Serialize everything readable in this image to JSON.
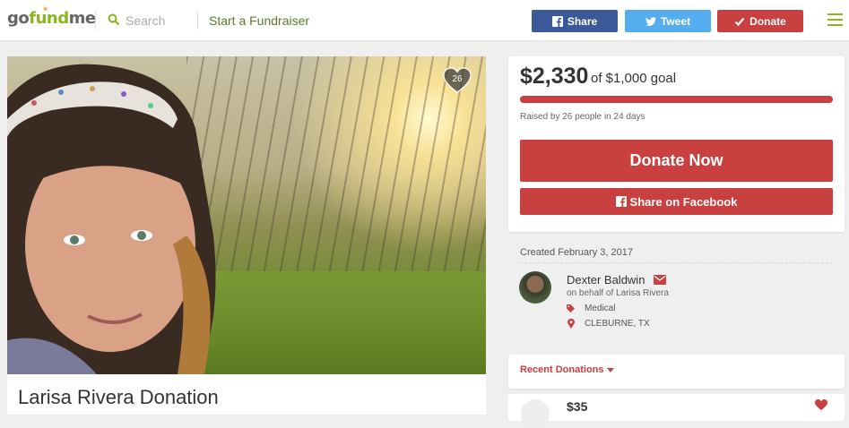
{
  "header": {
    "logo_go": "go",
    "logo_fund": "fund",
    "logo_me": "me",
    "search_placeholder": "Search",
    "start_link": "Start a Fundraiser",
    "share_label": "Share",
    "tweet_label": "Tweet",
    "donate_label": "Donate"
  },
  "campaign": {
    "title": "Larisa Rivera Donation",
    "heart_count": "26"
  },
  "goal": {
    "raised": "$2,330",
    "goal_text": "of $1,000 goal",
    "progress": 1.0,
    "raised_by": "Raised by 26 people in 24 days",
    "donate_now": "Donate Now",
    "share_facebook": "Share on Facebook"
  },
  "organizer": {
    "created": "Created February 3, 2017",
    "name": "Dexter Baldwin",
    "on_behalf": "on behalf of Larisa Rivera",
    "category": "Medical",
    "location": "CLEBURNE, TX"
  },
  "recent": {
    "label": "Recent Donations",
    "first_amount": "$35"
  },
  "colors": {
    "brand_green": "#8ab61f",
    "donate_red": "#c8403f",
    "facebook_blue": "#3b5998",
    "twitter_blue": "#55acee"
  }
}
